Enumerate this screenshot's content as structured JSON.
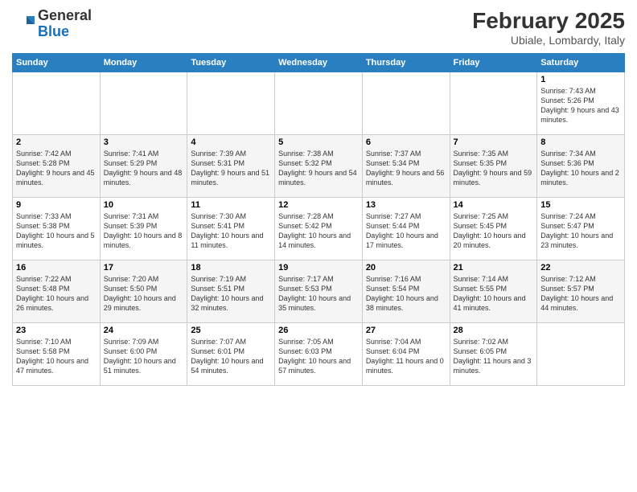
{
  "header": {
    "logo": {
      "general": "General",
      "blue": "Blue"
    },
    "month_year": "February 2025",
    "location": "Ubiale, Lombardy, Italy"
  },
  "days_of_week": [
    "Sunday",
    "Monday",
    "Tuesday",
    "Wednesday",
    "Thursday",
    "Friday",
    "Saturday"
  ],
  "weeks": [
    [
      {
        "day": "",
        "info": ""
      },
      {
        "day": "",
        "info": ""
      },
      {
        "day": "",
        "info": ""
      },
      {
        "day": "",
        "info": ""
      },
      {
        "day": "",
        "info": ""
      },
      {
        "day": "",
        "info": ""
      },
      {
        "day": "1",
        "info": "Sunrise: 7:43 AM\nSunset: 5:26 PM\nDaylight: 9 hours and 43 minutes."
      }
    ],
    [
      {
        "day": "2",
        "info": "Sunrise: 7:42 AM\nSunset: 5:28 PM\nDaylight: 9 hours and 45 minutes."
      },
      {
        "day": "3",
        "info": "Sunrise: 7:41 AM\nSunset: 5:29 PM\nDaylight: 9 hours and 48 minutes."
      },
      {
        "day": "4",
        "info": "Sunrise: 7:39 AM\nSunset: 5:31 PM\nDaylight: 9 hours and 51 minutes."
      },
      {
        "day": "5",
        "info": "Sunrise: 7:38 AM\nSunset: 5:32 PM\nDaylight: 9 hours and 54 minutes."
      },
      {
        "day": "6",
        "info": "Sunrise: 7:37 AM\nSunset: 5:34 PM\nDaylight: 9 hours and 56 minutes."
      },
      {
        "day": "7",
        "info": "Sunrise: 7:35 AM\nSunset: 5:35 PM\nDaylight: 9 hours and 59 minutes."
      },
      {
        "day": "8",
        "info": "Sunrise: 7:34 AM\nSunset: 5:36 PM\nDaylight: 10 hours and 2 minutes."
      }
    ],
    [
      {
        "day": "9",
        "info": "Sunrise: 7:33 AM\nSunset: 5:38 PM\nDaylight: 10 hours and 5 minutes."
      },
      {
        "day": "10",
        "info": "Sunrise: 7:31 AM\nSunset: 5:39 PM\nDaylight: 10 hours and 8 minutes."
      },
      {
        "day": "11",
        "info": "Sunrise: 7:30 AM\nSunset: 5:41 PM\nDaylight: 10 hours and 11 minutes."
      },
      {
        "day": "12",
        "info": "Sunrise: 7:28 AM\nSunset: 5:42 PM\nDaylight: 10 hours and 14 minutes."
      },
      {
        "day": "13",
        "info": "Sunrise: 7:27 AM\nSunset: 5:44 PM\nDaylight: 10 hours and 17 minutes."
      },
      {
        "day": "14",
        "info": "Sunrise: 7:25 AM\nSunset: 5:45 PM\nDaylight: 10 hours and 20 minutes."
      },
      {
        "day": "15",
        "info": "Sunrise: 7:24 AM\nSunset: 5:47 PM\nDaylight: 10 hours and 23 minutes."
      }
    ],
    [
      {
        "day": "16",
        "info": "Sunrise: 7:22 AM\nSunset: 5:48 PM\nDaylight: 10 hours and 26 minutes."
      },
      {
        "day": "17",
        "info": "Sunrise: 7:20 AM\nSunset: 5:50 PM\nDaylight: 10 hours and 29 minutes."
      },
      {
        "day": "18",
        "info": "Sunrise: 7:19 AM\nSunset: 5:51 PM\nDaylight: 10 hours and 32 minutes."
      },
      {
        "day": "19",
        "info": "Sunrise: 7:17 AM\nSunset: 5:53 PM\nDaylight: 10 hours and 35 minutes."
      },
      {
        "day": "20",
        "info": "Sunrise: 7:16 AM\nSunset: 5:54 PM\nDaylight: 10 hours and 38 minutes."
      },
      {
        "day": "21",
        "info": "Sunrise: 7:14 AM\nSunset: 5:55 PM\nDaylight: 10 hours and 41 minutes."
      },
      {
        "day": "22",
        "info": "Sunrise: 7:12 AM\nSunset: 5:57 PM\nDaylight: 10 hours and 44 minutes."
      }
    ],
    [
      {
        "day": "23",
        "info": "Sunrise: 7:10 AM\nSunset: 5:58 PM\nDaylight: 10 hours and 47 minutes."
      },
      {
        "day": "24",
        "info": "Sunrise: 7:09 AM\nSunset: 6:00 PM\nDaylight: 10 hours and 51 minutes."
      },
      {
        "day": "25",
        "info": "Sunrise: 7:07 AM\nSunset: 6:01 PM\nDaylight: 10 hours and 54 minutes."
      },
      {
        "day": "26",
        "info": "Sunrise: 7:05 AM\nSunset: 6:03 PM\nDaylight: 10 hours and 57 minutes."
      },
      {
        "day": "27",
        "info": "Sunrise: 7:04 AM\nSunset: 6:04 PM\nDaylight: 11 hours and 0 minutes."
      },
      {
        "day": "28",
        "info": "Sunrise: 7:02 AM\nSunset: 6:05 PM\nDaylight: 11 hours and 3 minutes."
      },
      {
        "day": "",
        "info": ""
      }
    ]
  ]
}
